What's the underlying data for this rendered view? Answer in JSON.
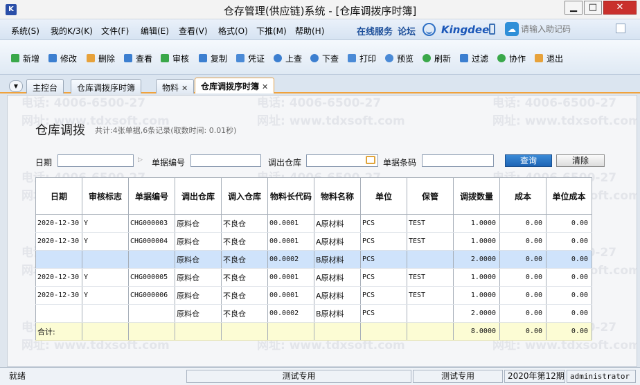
{
  "window": {
    "app_icon": "K",
    "title": "仓存管理(供应链)系统 - [仓库调拨序时簿]",
    "min": "▁",
    "max": "□",
    "close": "✕"
  },
  "menu": {
    "items": [
      "系统(S)",
      "我的K/3(K)",
      "文件(F)",
      "编辑(E)",
      "查看(V)",
      "格式(O)",
      "下推(M)",
      "帮助(H)"
    ],
    "online_service": "在线服务",
    "forum": "论坛",
    "brand": "Kingdee",
    "helper_placeholder": "请输入助记码"
  },
  "toolbar": {
    "buttons": [
      {
        "label": "新增",
        "icon": "add-icon",
        "color": "#3aa84a"
      },
      {
        "label": "修改",
        "icon": "edit-icon",
        "color": "#3c7fd0"
      },
      {
        "label": "删除",
        "icon": "delete-icon",
        "color": "#e7a23b"
      },
      {
        "label": "查看",
        "icon": "view-icon",
        "color": "#3c7fd0"
      },
      {
        "label": "审核",
        "icon": "approve-icon",
        "color": "#3aa84a"
      },
      {
        "label": "复制",
        "icon": "copy-icon",
        "color": "#3c7fd0"
      },
      {
        "label": "凭证",
        "icon": "voucher-icon",
        "color": "#4a8ad6"
      },
      {
        "label": "上查",
        "icon": "prev-icon",
        "color": "#3c7fd0"
      },
      {
        "label": "下查",
        "icon": "next-icon",
        "color": "#3c7fd0"
      },
      {
        "label": "打印",
        "icon": "print-icon",
        "color": "#4a8ad6"
      },
      {
        "label": "预览",
        "icon": "preview-icon",
        "color": "#4a8ad6"
      },
      {
        "label": "刷新",
        "icon": "refresh-icon",
        "color": "#3aa84a"
      },
      {
        "label": "过滤",
        "icon": "filter-icon",
        "color": "#3c7fd0"
      },
      {
        "label": "协作",
        "icon": "collaborate-icon",
        "color": "#3aa84a"
      },
      {
        "label": "退出",
        "icon": "exit-icon",
        "color": "#e7a23b"
      }
    ]
  },
  "tabs": [
    {
      "label": "主控台",
      "closable": false
    },
    {
      "label": "仓库调拨序时簿",
      "closable": false
    },
    {
      "label": "物料",
      "closable": true
    },
    {
      "label": "仓库调拨序时簿",
      "closable": true,
      "active": true
    }
  ],
  "page": {
    "heading": "仓库调拨",
    "summary": "共计:4张单据,6条记录(取数时间: 0.01秒)"
  },
  "filters": {
    "date_label": "日期",
    "bill_no_label": "单据编号",
    "out_wh_label": "调出仓库",
    "barcode_label": "单据条码",
    "query_btn": "查询",
    "clear_btn": "清除"
  },
  "table": {
    "columns": [
      "日期",
      "审核标志",
      "单据编号",
      "调出仓库",
      "调入仓库",
      "物料长代码",
      "物料名称",
      "单位",
      "保管",
      "调拨数量",
      "成本",
      "单位成本"
    ],
    "rows": [
      [
        "2020-12-30",
        "Y",
        "CHG000003",
        "原料仓",
        "不良仓",
        "00.0001",
        "A原材料",
        "PCS",
        "TEST",
        "1.0000",
        "0.00",
        "0.00"
      ],
      [
        "2020-12-30",
        "Y",
        "CHG000004",
        "原料仓",
        "不良仓",
        "00.0001",
        "A原材料",
        "PCS",
        "TEST",
        "1.0000",
        "0.00",
        "0.00"
      ],
      [
        "",
        "",
        "",
        "原料仓",
        "不良仓",
        "00.0002",
        "B原材料",
        "PCS",
        "",
        "2.0000",
        "0.00",
        "0.00"
      ],
      [
        "2020-12-30",
        "Y",
        "CHG000005",
        "原料仓",
        "不良仓",
        "00.0001",
        "A原材料",
        "PCS",
        "TEST",
        "1.0000",
        "0.00",
        "0.00"
      ],
      [
        "2020-12-30",
        "Y",
        "CHG000006",
        "原料仓",
        "不良仓",
        "00.0001",
        "A原材料",
        "PCS",
        "TEST",
        "1.0000",
        "0.00",
        "0.00"
      ],
      [
        "",
        "",
        "",
        "原料仓",
        "不良仓",
        "00.0002",
        "B原材料",
        "PCS",
        "",
        "2.0000",
        "0.00",
        "0.00"
      ]
    ],
    "selected_row": 2,
    "total": {
      "label": "合计:",
      "qty": "8.0000",
      "cost": "0.00",
      "unit_cost": "0.00"
    }
  },
  "watermarks": {
    "phone": "电话: 4006-6500-27",
    "site": "网址: www.tdxsoft.com"
  },
  "status": {
    "ready": "就绪",
    "test1": "测试专用",
    "test2": "测试专用",
    "period": "2020年第12期",
    "user": "administrator"
  }
}
